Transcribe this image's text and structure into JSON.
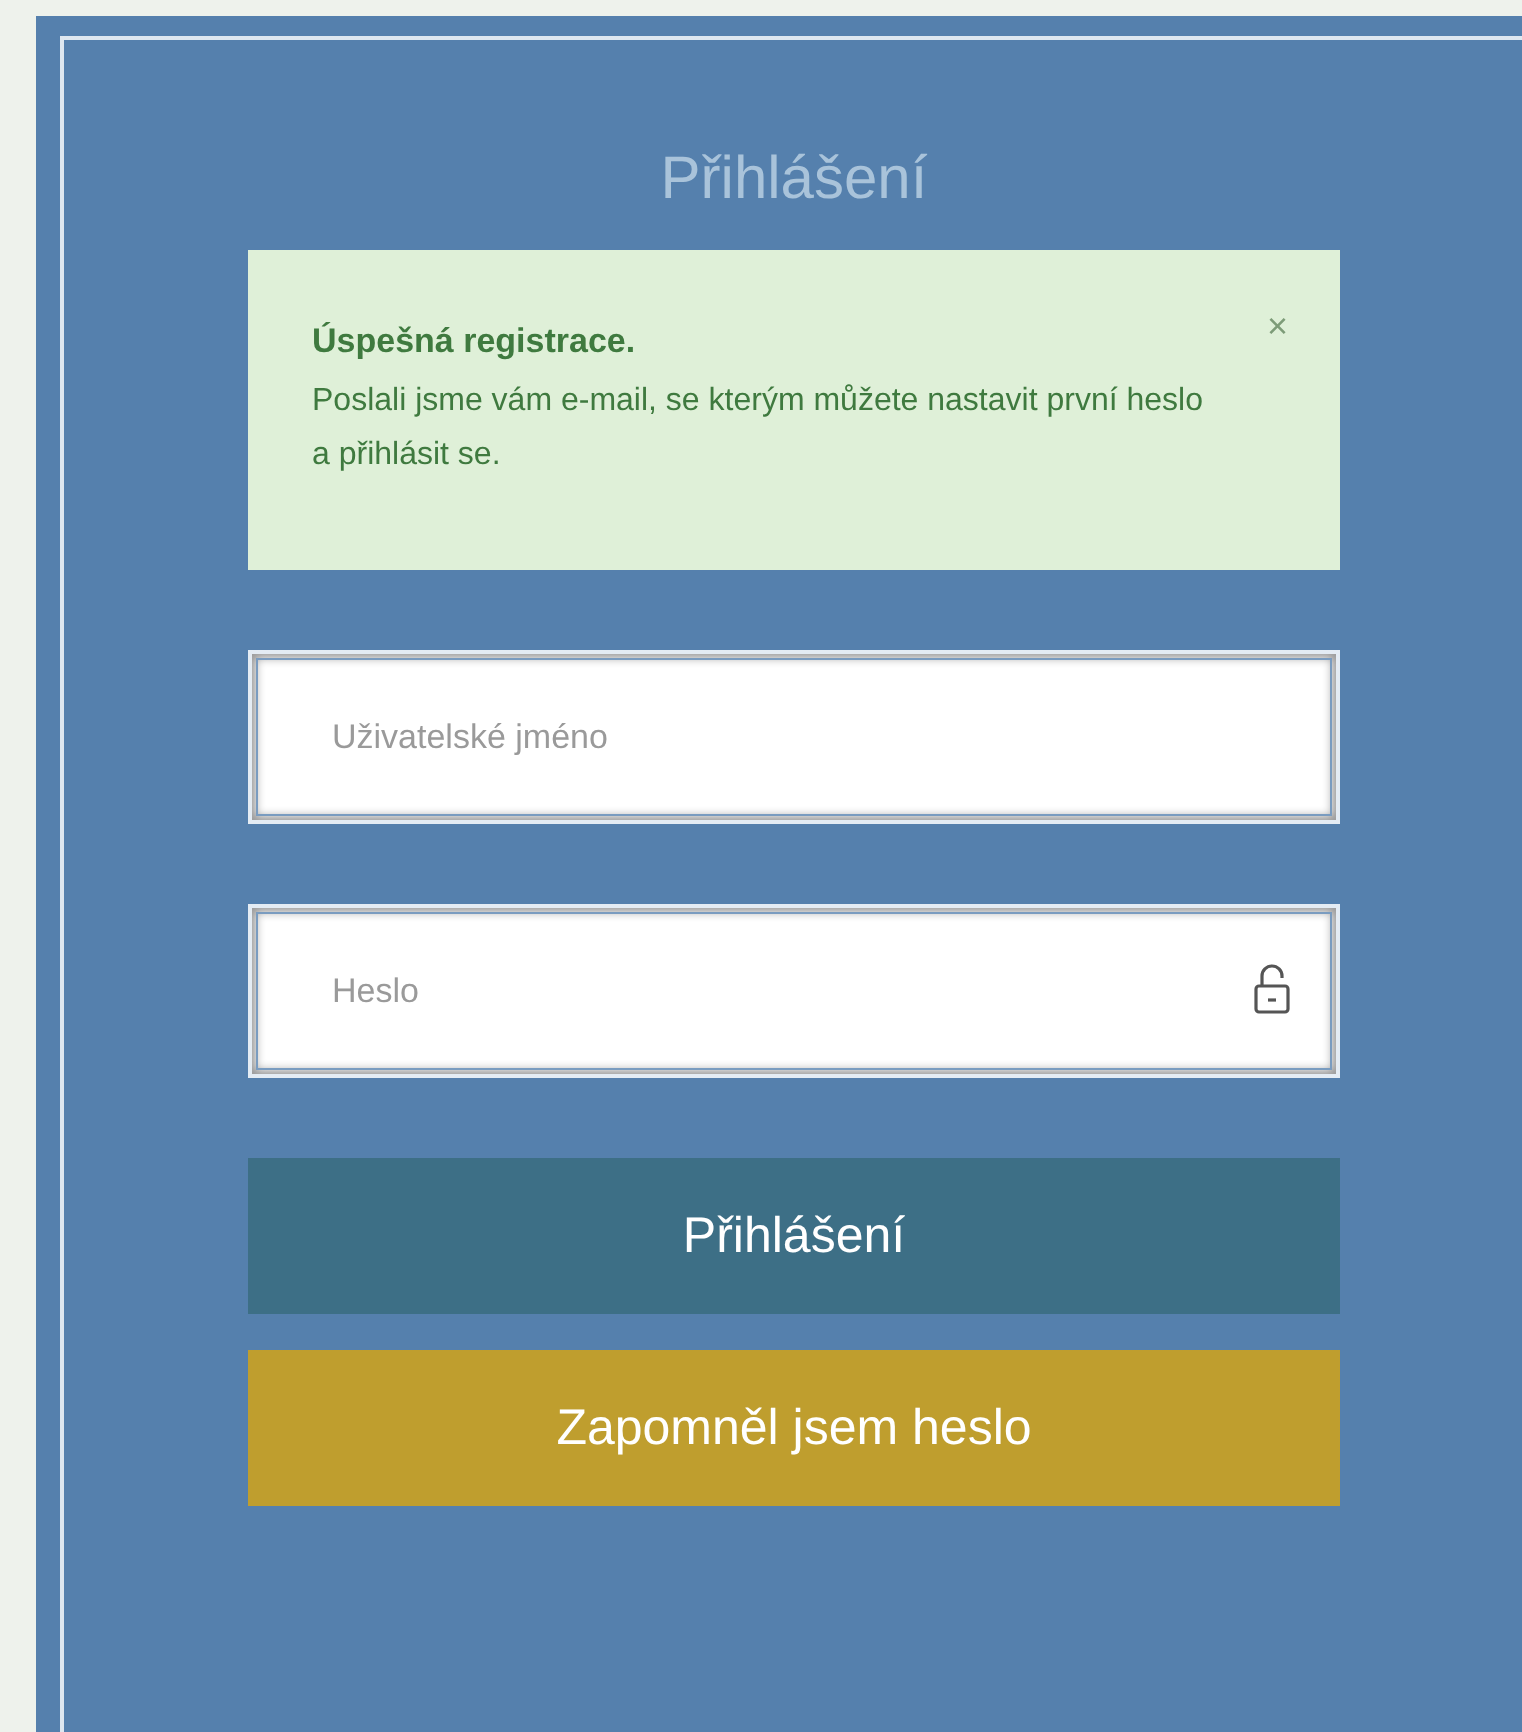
{
  "title": "Přihlášení",
  "alert": {
    "title": "Úspešná registrace.",
    "message": "Poslali jsme vám e-mail, se kterým můžete nastavit první heslo a přihlásit se.",
    "close": "×"
  },
  "fields": [
    {
      "placeholder": "Uživatelské jméno",
      "kind": "text"
    },
    {
      "placeholder": "Heslo",
      "kind": "password"
    }
  ],
  "buttons": [
    {
      "label": "Přihlášení",
      "kind": "primary"
    },
    {
      "label": "Zapomněl jsem heslo",
      "kind": "secondary"
    }
  ]
}
